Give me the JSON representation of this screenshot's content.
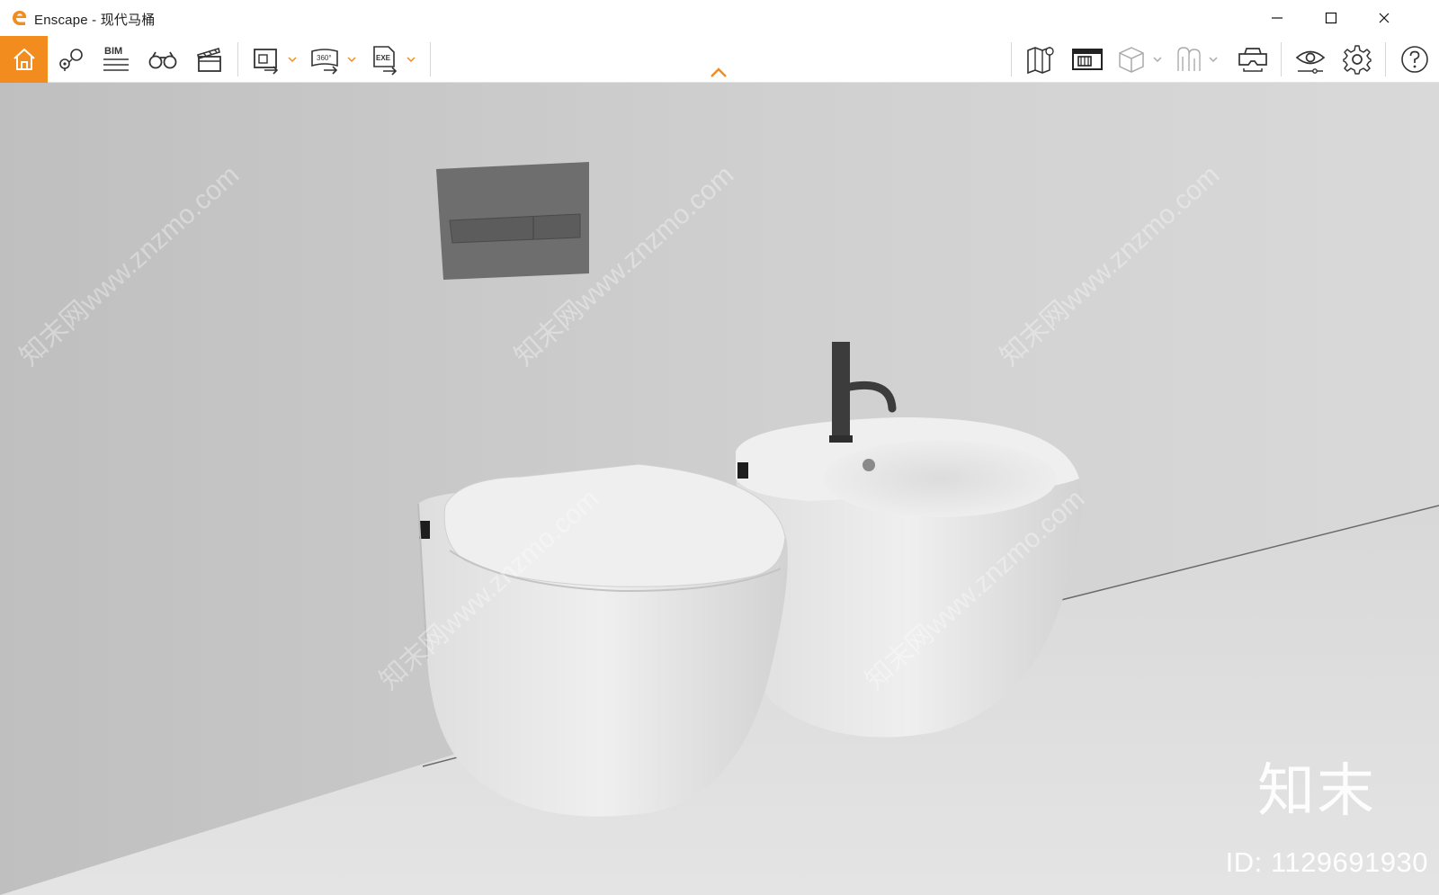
{
  "window": {
    "app_name": "Enscape",
    "title": "Enscape - 现代马桶",
    "minimize_icon": "minimize-icon",
    "maximize_icon": "maximize-icon",
    "close_icon": "close-icon"
  },
  "toolbar": {
    "left_tools": [
      {
        "name": "home",
        "icon": "home-icon",
        "active": true
      },
      {
        "name": "views",
        "icon": "location-icon"
      },
      {
        "name": "bim",
        "icon": "bim-icon",
        "label": "BIM"
      },
      {
        "name": "walk",
        "icon": "binoculars-icon"
      },
      {
        "name": "video",
        "icon": "clapperboard-icon"
      },
      {
        "name": "export-screenshot",
        "icon": "image-export-icon"
      },
      {
        "name": "export-panorama",
        "icon": "panorama-export-icon",
        "label": "360°"
      },
      {
        "name": "export-exe",
        "icon": "exe-export-icon",
        "label": "EXE"
      }
    ],
    "right_tools": [
      {
        "name": "map",
        "icon": "map-icon"
      },
      {
        "name": "asset-library",
        "icon": "asset-library-icon"
      },
      {
        "name": "material",
        "icon": "cube-icon"
      },
      {
        "name": "vr",
        "icon": "vr-icon"
      },
      {
        "name": "headset",
        "icon": "headset-icon"
      },
      {
        "name": "visual-settings",
        "icon": "eye-icon"
      },
      {
        "name": "settings",
        "icon": "gear-icon"
      },
      {
        "name": "help",
        "icon": "help-icon"
      }
    ],
    "accent_color": "#f28c1e"
  },
  "viewport": {
    "watermark_brand": "知末",
    "watermark_id": "ID: 1129691930",
    "watermark_diagonal": "知末网www.znzmo.com"
  }
}
